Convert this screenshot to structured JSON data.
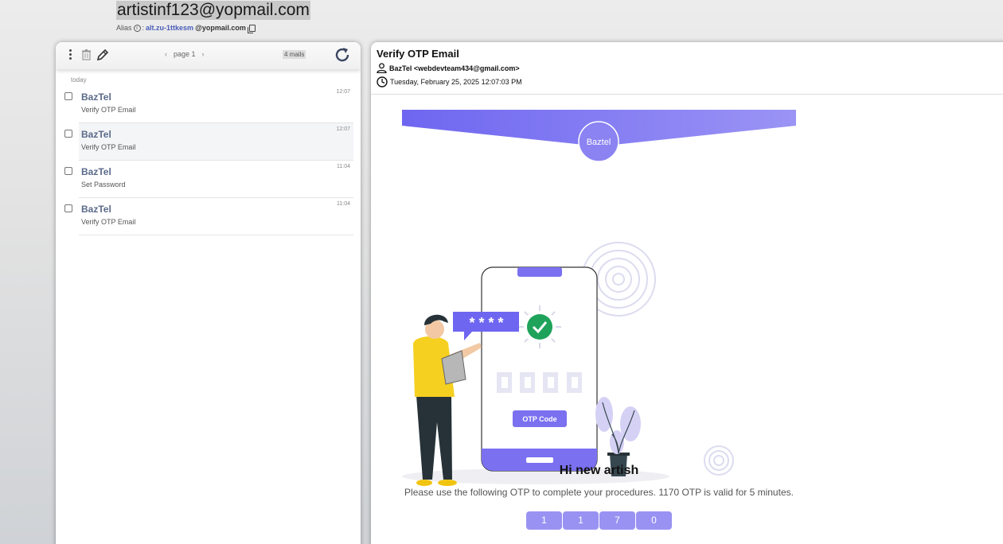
{
  "header": {
    "email": "artistinf123@yopmail.com",
    "alias_label": "Alias",
    "alias_sep": ":",
    "alias_local": "alt.zu-1ttkesm",
    "alias_domain": "@yopmail.com"
  },
  "list": {
    "pager": "page 1",
    "pager_prev": "‹",
    "pager_next": "›",
    "count": "4 mails",
    "day_label": "today",
    "items": [
      {
        "from": "BazTel",
        "subject": "Verify OTP Email",
        "time": "12:07"
      },
      {
        "from": "BazTel",
        "subject": "Verify OTP Email",
        "time": "12:07"
      },
      {
        "from": "BazTel",
        "subject": "Set Password",
        "time": "11:04"
      },
      {
        "from": "BazTel",
        "subject": "Verify OTP Email",
        "time": "11:04"
      }
    ]
  },
  "reader": {
    "subject": "Verify OTP Email",
    "from": "BazTel <webdevteam434@gmail.com>",
    "date": "Tuesday, February 25, 2025 12:07:03 PM"
  },
  "email": {
    "logo_text": "Baztel",
    "mask_text": "* * * *",
    "otp_button": "OTP Code",
    "greeting": "Hi new artish",
    "message": "Please use the following OTP to complete your procedures. 1170 OTP is valid for 5 minutes.",
    "otp_digits": [
      "1",
      "1",
      "7",
      "0"
    ]
  },
  "colors": {
    "accent": "#7a70f0",
    "accent_light": "#9a92f2",
    "sender": "#5a6a8a"
  }
}
